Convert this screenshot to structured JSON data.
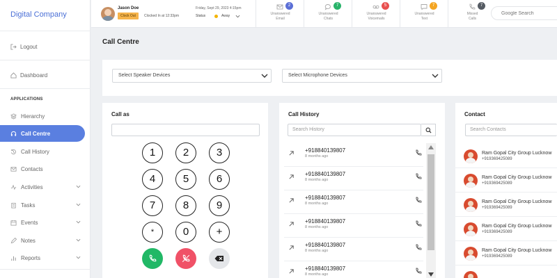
{
  "brand": "Digital Company",
  "sidebar": {
    "logout": "Logout",
    "dashboard": "Dashboard",
    "section": "APPLICATIONS",
    "items": [
      {
        "label": "Hierarchy"
      },
      {
        "label": "Call Centre"
      },
      {
        "label": "Call History"
      },
      {
        "label": "Contacts"
      },
      {
        "label": "Activities"
      },
      {
        "label": "Tasks"
      },
      {
        "label": "Events"
      },
      {
        "label": "Notes"
      },
      {
        "label": "Reports"
      }
    ]
  },
  "header": {
    "user_name": "Jason Doe",
    "clock_out": "Clock Out",
    "clocked_in": "Clocked In at 12:33pm",
    "date": "Friday, Sept 29, 2023 4:15pm",
    "status_label": "Status",
    "status_value": "Away",
    "stats": [
      {
        "label": "Unanswered Email",
        "line1": "Unanswered",
        "line2": "Email",
        "count": "2",
        "color": "#5b6fd6"
      },
      {
        "label": "Unanswered Chats",
        "line1": "Unanswered",
        "line2": "Chats",
        "count": "7",
        "color": "#29b36a"
      },
      {
        "label": "Unanswered Voicemails",
        "line1": "Unanswered",
        "line2": "Voicemails",
        "count": "5",
        "color": "#e8504f"
      },
      {
        "label": "Unanswered Text",
        "line1": "Unanswered",
        "line2": "Text",
        "count": "7",
        "color": "#f4a522"
      },
      {
        "label": "Missed Calls",
        "line1": "Missed",
        "line2": "Calls",
        "count": "7",
        "color": "#555b63"
      }
    ],
    "search_placeholder": "Google Search"
  },
  "page_title": "Call Centre",
  "devices": {
    "speaker": "Select Speaker Devices",
    "microphone": "Select Microphone Devices"
  },
  "call_as": {
    "title": "Call as",
    "keys": [
      "1",
      "2",
      "3",
      "4",
      "5",
      "6",
      "7",
      "8",
      "9",
      "*",
      "0",
      "+"
    ],
    "call_color": "#21b866",
    "hangup_color": "#f05167"
  },
  "history": {
    "title": "Call History",
    "search_placeholder": "Search History",
    "rows": [
      {
        "number": "+918840139807",
        "ago": "8 months ago"
      },
      {
        "number": "+918840139807",
        "ago": "8 months ago"
      },
      {
        "number": "+918840139807",
        "ago": "8 months ago"
      },
      {
        "number": "+918840139807",
        "ago": "8 months ago"
      },
      {
        "number": "+918840139807",
        "ago": "8 months ago"
      },
      {
        "number": "+918840139807",
        "ago": "8 months ago"
      }
    ]
  },
  "contacts": {
    "title": "Contact",
    "search_placeholder": "Search Contacts",
    "rows": [
      {
        "name": "Ram Gopal City Group Lucknow",
        "phone": "+919369425089"
      },
      {
        "name": "Ram Gopal City Group Lucknow",
        "phone": "+919369425089"
      },
      {
        "name": "Ram Gopal City Group Lucknow",
        "phone": "+919369425089"
      },
      {
        "name": "Ram Gopal City Group Lucknow",
        "phone": "+919369425089"
      },
      {
        "name": "Ram Gopal City Group Lucknow",
        "phone": "+919369425089"
      }
    ]
  }
}
